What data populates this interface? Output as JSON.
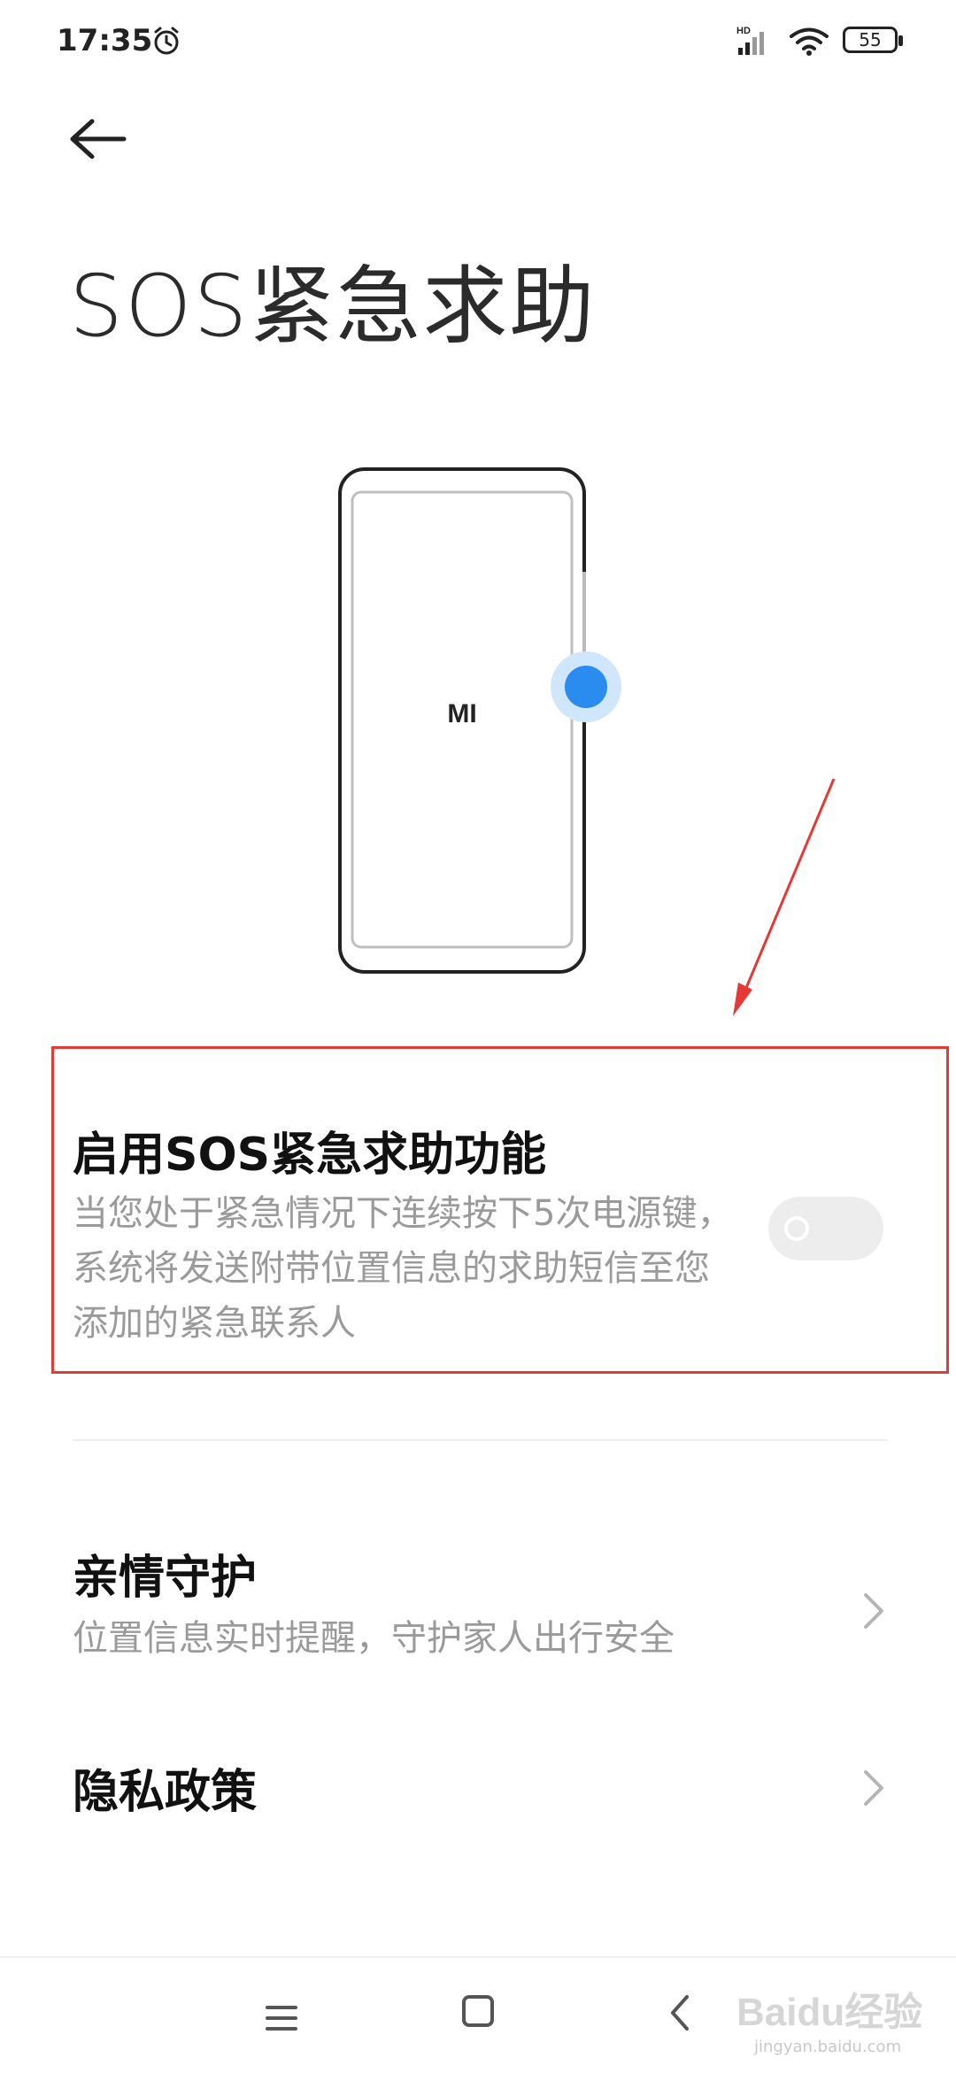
{
  "status_bar": {
    "time": "17:35",
    "network": "HD",
    "battery": "55"
  },
  "icons": {
    "back": "arrow-left-icon",
    "alarm": "alarm-clock-icon",
    "signal": "cellular-signal-icon",
    "wifi": "wifi-icon",
    "chevron": "chevron-right-icon"
  },
  "page": {
    "title": "SOS紧急求助"
  },
  "illustration": {
    "logo_text": "MI"
  },
  "sos_setting": {
    "title": "启用SOS紧急求助功能",
    "description": "当您处于紧急情况下连续按下5次电源键，系统将发送附带位置信息的求助短信至您添加的紧急联系人",
    "enabled": false
  },
  "settings_list": [
    {
      "title": "亲情守护",
      "subtitle": "位置信息实时提醒，守护家人出行安全"
    },
    {
      "title": "隐私政策",
      "subtitle": ""
    }
  ],
  "watermark": {
    "brand": "Baidu经验",
    "url": "jingyan.baidu.com"
  },
  "colors": {
    "highlight_border": "#e53935",
    "accent_blue": "#2b8cf0",
    "toggle_off": "#ededed"
  }
}
